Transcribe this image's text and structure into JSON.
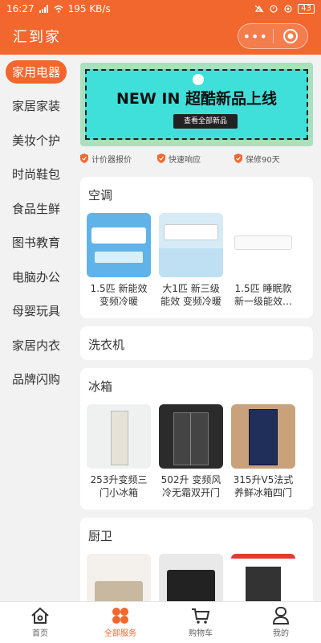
{
  "status_bar": {
    "time": "16:27",
    "speed": "195 KB/s",
    "battery": "43"
  },
  "header": {
    "title": "汇到家",
    "more_glyph": "•••"
  },
  "sidebar": {
    "items": [
      {
        "label": "家用电器",
        "active": true
      },
      {
        "label": "家居家装"
      },
      {
        "label": "美妆个护"
      },
      {
        "label": "时尚鞋包"
      },
      {
        "label": "食品生鲜"
      },
      {
        "label": "图书教育"
      },
      {
        "label": "电脑办公"
      },
      {
        "label": "母婴玩具"
      },
      {
        "label": "家居内衣"
      },
      {
        "label": "品牌闪购"
      }
    ]
  },
  "banner": {
    "title": "NEW IN 超酷新品上线",
    "button": "查看全部新品"
  },
  "promises": [
    "计价器报价",
    "快速响应",
    "保修90天"
  ],
  "categories": [
    {
      "title": "空调",
      "products": [
        {
          "name": "1.5匹 新能效 变频冷暖"
        },
        {
          "name": "大1匹 新三级能效 变频冷暖"
        },
        {
          "name": "1.5匹 睡眠款 新一级能效…"
        }
      ]
    },
    {
      "title": "洗衣机",
      "products": []
    },
    {
      "title": "冰箱",
      "products": [
        {
          "name": "253升变频三门小冰箱"
        },
        {
          "name": "502升 变频风冷无霜双开门"
        },
        {
          "name": "315升V5法式养鲜冰箱四门"
        }
      ]
    },
    {
      "title": "厨卫",
      "products": []
    }
  ],
  "tabbar": {
    "items": [
      {
        "label": "首页"
      },
      {
        "label": "全部服务",
        "active": true
      },
      {
        "label": "购物车"
      },
      {
        "label": "我的"
      }
    ]
  },
  "colors": {
    "accent": "#f2672e",
    "background": "#f2f2f2"
  }
}
